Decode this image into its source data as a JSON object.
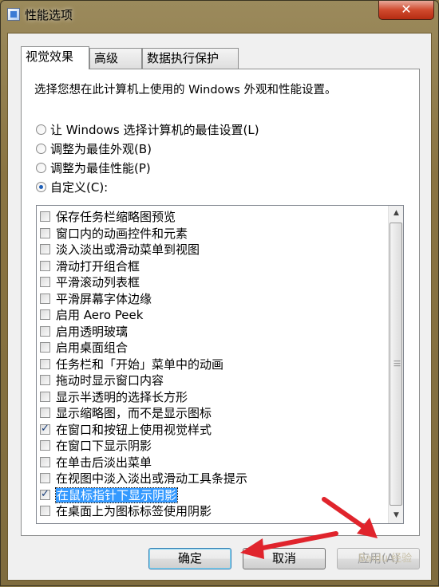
{
  "window": {
    "title": "性能选项",
    "close_glyph": "✕"
  },
  "tabs": [
    {
      "label": "视觉效果",
      "active": true
    },
    {
      "label": "高级",
      "active": false
    },
    {
      "label": "数据执行保护",
      "active": false
    }
  ],
  "description": "选择您想在此计算机上使用的 Windows 外观和性能设置。",
  "radios": [
    {
      "label": "让 Windows 选择计算机的最佳设置(L)",
      "checked": false
    },
    {
      "label": "调整为最佳外观(B)",
      "checked": false
    },
    {
      "label": "调整为最佳性能(P)",
      "checked": false
    },
    {
      "label": "自定义(C):",
      "checked": true
    }
  ],
  "options": [
    {
      "label": "保存任务栏缩略图预览",
      "checked": false
    },
    {
      "label": "窗口内的动画控件和元素",
      "checked": false
    },
    {
      "label": "淡入淡出或滑动菜单到视图",
      "checked": false
    },
    {
      "label": "滑动打开组合框",
      "checked": false
    },
    {
      "label": "平滑滚动列表框",
      "checked": false
    },
    {
      "label": "平滑屏幕字体边缘",
      "checked": false
    },
    {
      "label": "启用 Aero Peek",
      "checked": false
    },
    {
      "label": "启用透明玻璃",
      "checked": false
    },
    {
      "label": "启用桌面组合",
      "checked": false
    },
    {
      "label": "任务栏和「开始」菜单中的动画",
      "checked": false
    },
    {
      "label": "拖动时显示窗口内容",
      "checked": false
    },
    {
      "label": "显示半透明的选择长方形",
      "checked": false
    },
    {
      "label": "显示缩略图，而不是显示图标",
      "checked": false
    },
    {
      "label": "在窗口和按钮上使用视觉样式",
      "checked": true
    },
    {
      "label": "在窗口下显示阴影",
      "checked": false
    },
    {
      "label": "在单击后淡出菜单",
      "checked": false
    },
    {
      "label": "在视图中淡入淡出或滑动工具条提示",
      "checked": false
    },
    {
      "label": "在鼠标指针下显示阴影",
      "checked": true,
      "selected": true
    },
    {
      "label": "在桌面上为图标标签使用阴影",
      "checked": false
    }
  ],
  "buttons": {
    "ok": "确定",
    "cancel": "取消",
    "apply": "应用(A)"
  },
  "watermark": "Baidu 经验",
  "colors": {
    "annotation_arrow": "#e0242c",
    "selection": "#3399ff"
  }
}
